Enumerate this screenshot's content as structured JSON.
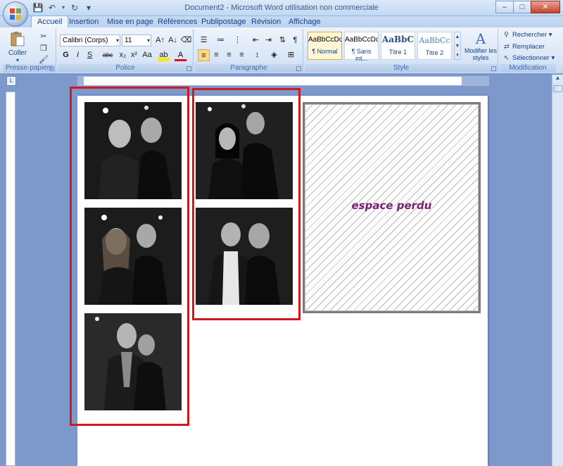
{
  "window": {
    "title": "Document2 - Microsoft Word utilisation non commerciale",
    "controls": {
      "minimize": "–",
      "maximize": "□",
      "close": "✕"
    }
  },
  "qat": {
    "save": "💾",
    "undo": "↶",
    "redo": "↻",
    "customize": "▾"
  },
  "tabs": [
    {
      "label": "Accueil",
      "active": true
    },
    {
      "label": "Insertion",
      "active": false
    },
    {
      "label": "Mise en page",
      "active": false
    },
    {
      "label": "Références",
      "active": false
    },
    {
      "label": "Publipostage",
      "active": false
    },
    {
      "label": "Révision",
      "active": false
    },
    {
      "label": "Affichage",
      "active": false
    }
  ],
  "ribbon": {
    "clipboard": {
      "label": "Presse-papiers",
      "paste": "Coller"
    },
    "font": {
      "label": "Police",
      "font_name": "Calibri (Corps)",
      "font_size": "11",
      "grow": "A↑",
      "shrink": "A↓",
      "clear": "⌫",
      "bold": "G",
      "italic": "I",
      "underline": "S",
      "strike": "abc",
      "subscript": "x₂",
      "superscript": "x²",
      "case": "Aa",
      "highlight": "ab",
      "color": "A"
    },
    "paragraph": {
      "label": "Paragraphe"
    },
    "styles": {
      "label": "Style",
      "items": [
        {
          "preview": "AaBbCcDc",
          "name": "¶ Normal",
          "selected": true
        },
        {
          "preview": "AaBbCcDc",
          "name": "¶ Sans int...",
          "selected": false
        },
        {
          "preview": "AaBbC",
          "name": "Titre 1",
          "selected": false
        },
        {
          "preview": "AaBbCc",
          "name": "Titre 2",
          "selected": false
        }
      ],
      "change": "Modifier les styles"
    },
    "editing": {
      "label": "Modification",
      "find": "Rechercher",
      "replace": "Remplacer",
      "select": "Sélectionner"
    }
  },
  "document": {
    "wasted_space_label": "espace perdu",
    "frame_color": "#d11a1f",
    "label_color": "#7a1f74"
  }
}
